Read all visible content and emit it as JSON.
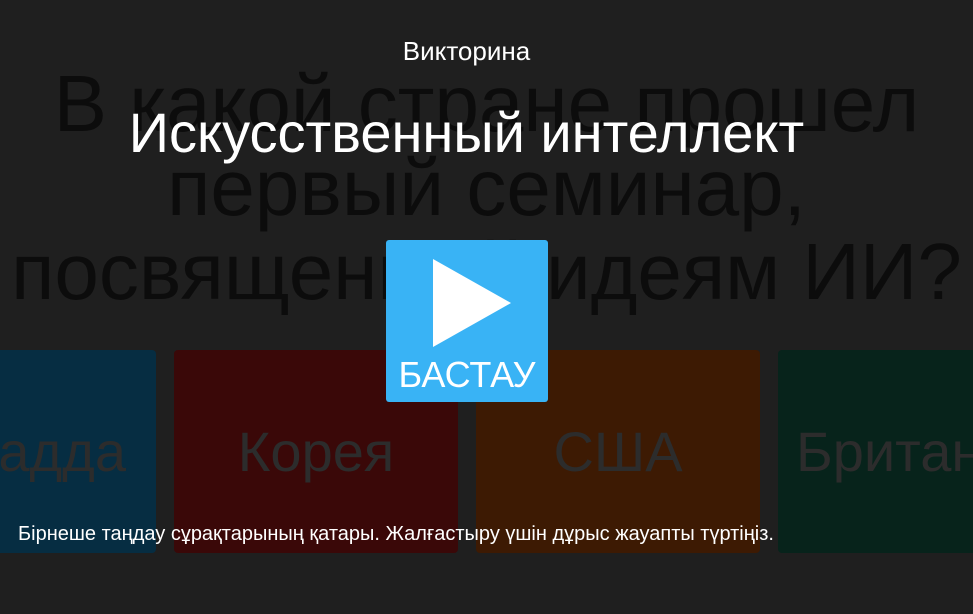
{
  "background": {
    "question_lines": [
      "В какой стране прошел",
      "первый семинар,",
      "посвященный идеям ИИ?"
    ],
    "answers": [
      {
        "label": "Канадда",
        "color": "#062d42"
      },
      {
        "label": "Корея",
        "color": "#3a0808"
      },
      {
        "label": "США",
        "color": "#3d1a03"
      },
      {
        "label": "Британия",
        "color": "#07231b"
      }
    ]
  },
  "overlay": {
    "quiz_type": "Викторина",
    "title": "Искусственный интеллект",
    "start_button": {
      "label": "БАСТАУ",
      "icon": "play-icon",
      "color": "#39b3f5"
    },
    "instructions": "Бірнеше таңдау сұрақтарының қатары. Жалғастыру үшін дұрыс жауапты түртіңіз."
  }
}
